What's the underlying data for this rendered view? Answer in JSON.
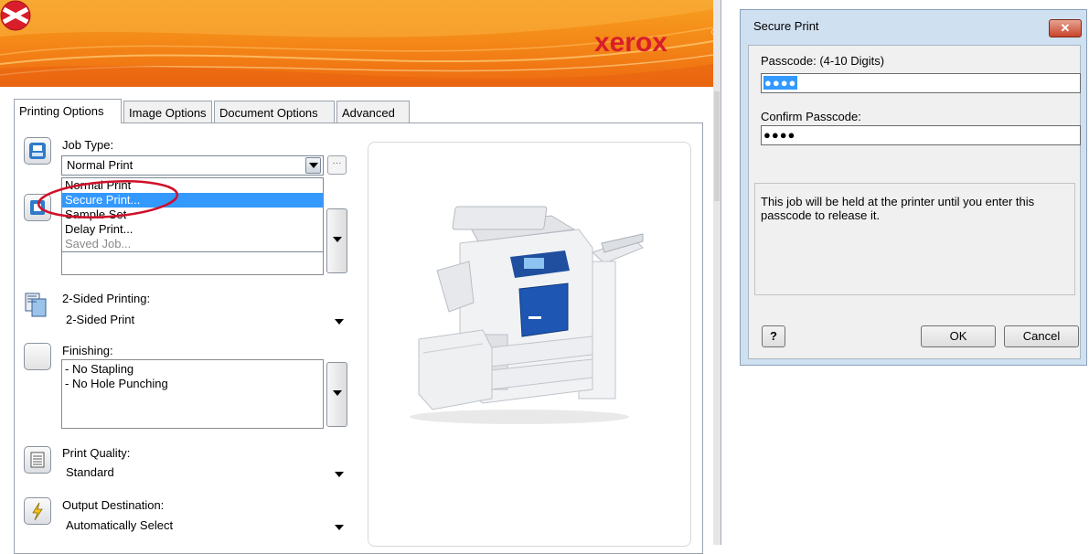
{
  "banner": {
    "brand": "xerox",
    "reg_mark": "®",
    "brand_color": "#d81e2a",
    "bg_color": "#f48a18"
  },
  "tabs": [
    {
      "label": "Printing Options",
      "active": true
    },
    {
      "label": "Image Options",
      "active": false
    },
    {
      "label": "Document Options",
      "active": false
    },
    {
      "label": "Advanced",
      "active": false
    }
  ],
  "job_type": {
    "label": "Job Type:",
    "value": "Normal Print",
    "more_button": "···",
    "options": [
      {
        "label": "Normal Print",
        "state": "normal"
      },
      {
        "label": "Secure Print...",
        "state": "highlighted"
      },
      {
        "label": "Sample Set",
        "state": "normal"
      },
      {
        "label": "Delay Print...",
        "state": "normal"
      },
      {
        "label": "Saved Job...",
        "state": "disabled"
      }
    ],
    "highlight_ring_color": "#d0102a"
  },
  "two_sided": {
    "label": "2-Sided Printing:",
    "value": "2-Sided Print"
  },
  "finishing": {
    "label": "Finishing:",
    "lines": [
      "- No Stapling",
      "- No Hole Punching"
    ]
  },
  "print_quality": {
    "label": "Print Quality:",
    "value": "Standard"
  },
  "output_destination": {
    "label": "Output Destination:",
    "value": "Automatically Select"
  },
  "dialog": {
    "title": "Secure Print",
    "close_glyph": "✕",
    "passcode_label": "Passcode: (4-10 Digits)",
    "passcode_value": "●●●●",
    "confirm_label": "Confirm Passcode:",
    "confirm_value": "●●●●",
    "info_text": "This job will be held at the printer until you enter this passcode to release it.",
    "help_label": "?",
    "ok_label": "OK",
    "cancel_label": "Cancel",
    "frame_color": "#cfe0f1",
    "selection_color": "#3399ff"
  }
}
